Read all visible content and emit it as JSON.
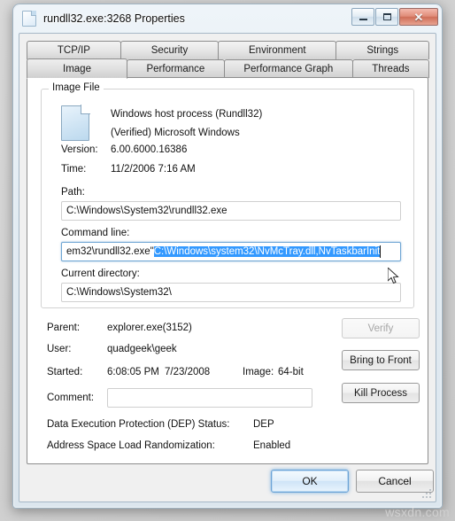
{
  "window": {
    "title": "rundll32.exe:3268 Properties",
    "icon": "document-icon",
    "caption_buttons": {
      "minimize": "–",
      "maximize": "□",
      "close": "✕"
    }
  },
  "tabs": {
    "row1": [
      {
        "label": "TCP/IP",
        "selected": false
      },
      {
        "label": "Security",
        "selected": false
      },
      {
        "label": "Environment",
        "selected": false
      },
      {
        "label": "Strings",
        "selected": false
      }
    ],
    "row2": [
      {
        "label": "Image",
        "selected": true
      },
      {
        "label": "Performance",
        "selected": false
      },
      {
        "label": "Performance Graph",
        "selected": false
      },
      {
        "label": "Threads",
        "selected": false
      }
    ]
  },
  "image_file": {
    "group_title": "Image File",
    "description": "Windows host process (Rundll32)",
    "publisher": "(Verified) Microsoft Windows",
    "version_label": "Version:",
    "version_value": "6.00.6000.16386",
    "time_label": "Time:",
    "time_value": "11/2/2006 7:16 AM",
    "path_label": "Path:",
    "path_value": "C:\\Windows\\System32\\rundll32.exe",
    "command_line_label": "Command line:",
    "command_line_prefix": "еm32\\rundll32.exe\"",
    "command_line_selected": "C:\\Windows\\system32\\NvMcTray.dll,NvTaskbarInit",
    "current_directory_label": "Current directory:",
    "current_directory_value": "C:\\Windows\\System32\\"
  },
  "process_info": {
    "parent_label": "Parent:",
    "parent_value": "explorer.exe(3152)",
    "user_label": "User:",
    "user_value": "quadgeek\\geek",
    "started_label": "Started:",
    "started_time": "6:08:05 PM",
    "started_date": "7/23/2008",
    "image_bitness_label": "Image:",
    "image_bitness_value": "64-bit",
    "comment_label": "Comment:",
    "comment_value": "",
    "dep_label": "Data Execution Protection (DEP) Status:",
    "dep_value": "DEP",
    "aslr_label": "Address Space Load Randomization:",
    "aslr_value": "Enabled"
  },
  "side_buttons": {
    "verify": "Verify",
    "bring_to_front": "Bring to Front",
    "kill_process": "Kill Process"
  },
  "dialog_buttons": {
    "ok": "OK",
    "cancel": "Cancel"
  },
  "watermark": "wsxdn.com",
  "colors": {
    "selection_blue": "#3399ff",
    "close_red": "#cf6e58",
    "tab_selected_bg": "#ffffff"
  }
}
